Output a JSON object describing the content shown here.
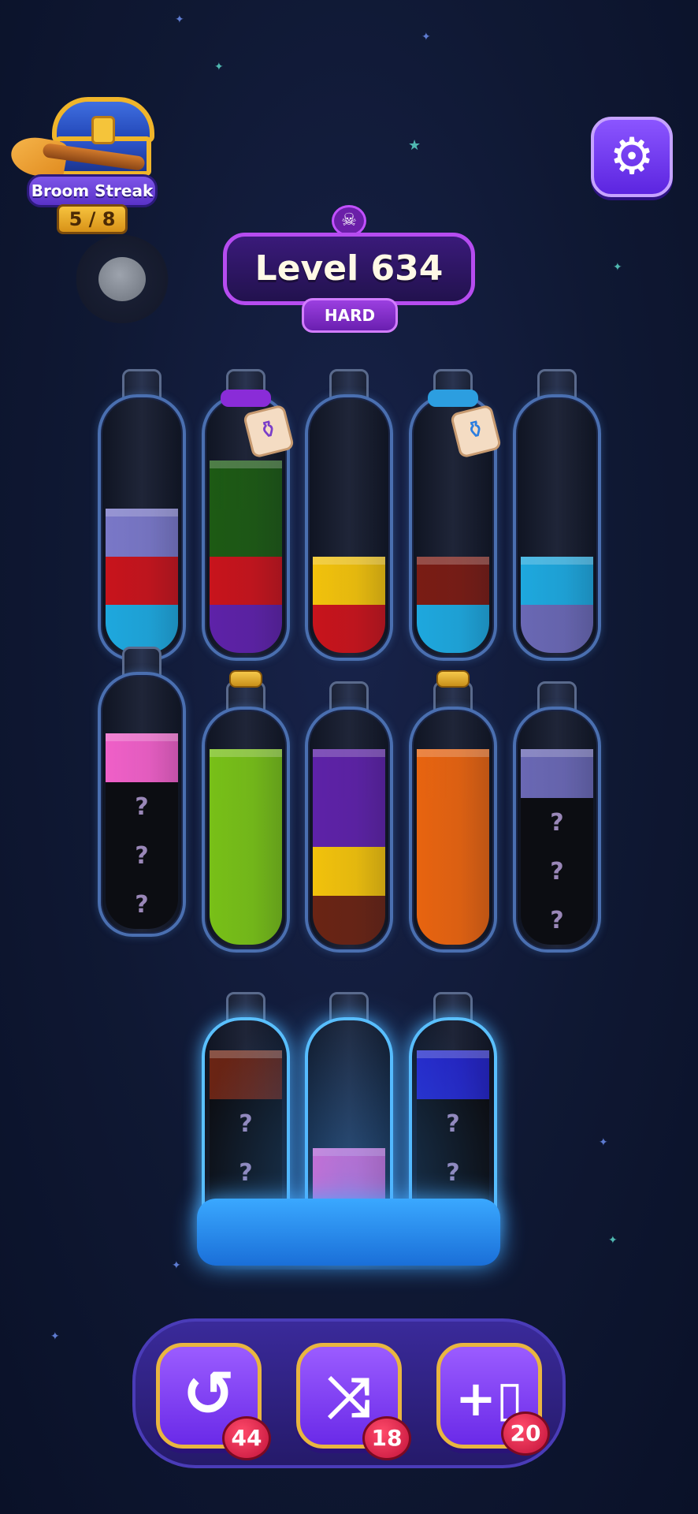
{
  "header": {
    "streak_label": "Broom Streak",
    "streak_count": "5 / 8",
    "settings_icon": "gear-icon"
  },
  "level": {
    "title": "Level 634",
    "difficulty": "HARD",
    "difficulty_icon": "skull-icon"
  },
  "tubes": {
    "row1": [
      {
        "layers": [
          {
            "color": "#7a78c8"
          },
          {
            "color": "#c8141c"
          },
          {
            "color": "#1ea8de"
          }
        ]
      },
      {
        "layers": [
          {
            "color": "#1d5a14"
          },
          {
            "color": "#1d5a14"
          },
          {
            "color": "#c8141c"
          },
          {
            "color": "#5e22a8"
          }
        ],
        "locked_tag": "purple"
      },
      {
        "layers": [
          {
            "color": "#f2c20c"
          },
          {
            "color": "#c8141c"
          }
        ]
      },
      {
        "layers": [
          {
            "color": "#7a1c14"
          },
          {
            "color": "#1ea8de"
          }
        ],
        "locked_tag": "blue"
      },
      {
        "layers": [
          {
            "color": "#1ea8de"
          },
          {
            "color": "#6a68b4"
          }
        ]
      }
    ],
    "row2": [
      {
        "layers": [
          {
            "color": "#f060c8"
          },
          {
            "hidden": true
          },
          {
            "hidden": true
          },
          {
            "hidden": true
          }
        ]
      },
      {
        "layers": [
          {
            "color": "#78c018"
          },
          {
            "color": "#78c018"
          },
          {
            "color": "#78c018"
          },
          {
            "color": "#78c018"
          }
        ],
        "corked": true
      },
      {
        "layers": [
          {
            "color": "#5e22a8"
          },
          {
            "color": "#5e22a8"
          },
          {
            "color": "#f2c20c"
          },
          {
            "color": "#6a2414"
          }
        ]
      },
      {
        "layers": [
          {
            "color": "#e86410"
          },
          {
            "color": "#e86410"
          },
          {
            "color": "#e86410"
          },
          {
            "color": "#e86410"
          }
        ],
        "corked": true
      },
      {
        "layers": [
          {
            "color": "#6a68b4"
          },
          {
            "hidden": true
          },
          {
            "hidden": true
          },
          {
            "hidden": true
          }
        ]
      }
    ],
    "row3": [
      {
        "layers": [
          {
            "color": "#6a2414"
          },
          {
            "hidden": true
          },
          {
            "hidden": true
          },
          {
            "hidden": true
          }
        ],
        "frozen": true
      },
      {
        "layers": [
          {
            "color": "#f060c8"
          },
          {
            "color": "#f060c8"
          }
        ],
        "frozen": true
      },
      {
        "layers": [
          {
            "color": "#2424c8"
          },
          {
            "hidden": true
          },
          {
            "hidden": true
          },
          {
            "hidden": true
          }
        ],
        "frozen": true
      }
    ],
    "hidden_mark": "?"
  },
  "toolbar": {
    "undo": {
      "icon": "undo-icon",
      "count": "44"
    },
    "shuffle": {
      "icon": "shuffle-icon",
      "count": "18"
    },
    "add_tube": {
      "icon": "add-bottle-icon",
      "count": "20"
    }
  }
}
